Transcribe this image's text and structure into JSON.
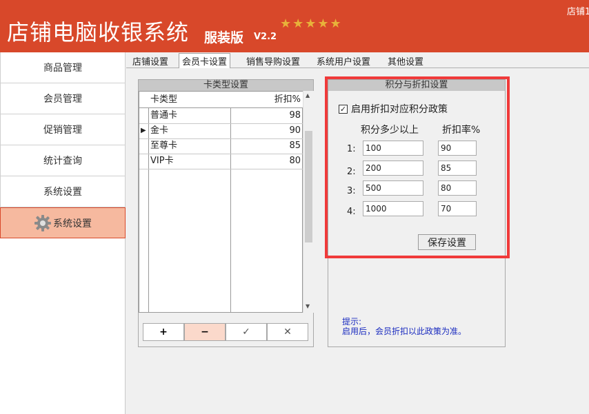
{
  "header": {
    "title": "店铺电脑收银系统",
    "edition": "服装版",
    "version": "V2.2",
    "stars": "★★★★★",
    "store": "店铺1"
  },
  "sidebar": {
    "items": [
      {
        "label": "商品管理"
      },
      {
        "label": "会员管理"
      },
      {
        "label": "促销管理"
      },
      {
        "label": "统计查询"
      },
      {
        "label": "系统设置"
      },
      {
        "label": "系统设置",
        "icon": "gear-icon"
      }
    ]
  },
  "tabs": [
    {
      "label": "店铺设置"
    },
    {
      "label": "会员卡设置"
    },
    {
      "label": "销售导购设置"
    },
    {
      "label": "系统用户设置"
    },
    {
      "label": "其他设置"
    }
  ],
  "card_types": {
    "title": "卡类型设置",
    "columns": [
      "卡类型",
      "折扣%"
    ],
    "rows": [
      {
        "name": "普通卡",
        "discount": "98"
      },
      {
        "name": "金卡",
        "discount": "90"
      },
      {
        "name": "至尊卡",
        "discount": "85"
      },
      {
        "name": "VIP卡",
        "discount": "80"
      }
    ],
    "buttons": {
      "add": "+",
      "remove": "−",
      "confirm": "✓",
      "cancel": "✕"
    }
  },
  "points": {
    "title": "积分与折扣设置",
    "checkbox_label": "启用折扣对应积分政策",
    "col_points": "积分多少以上",
    "col_rate": "折扣率%",
    "rows": [
      {
        "no": "1:",
        "points": "100",
        "rate": "90"
      },
      {
        "no": "2:",
        "points": "200",
        "rate": "85"
      },
      {
        "no": "3:",
        "points": "500",
        "rate": "80"
      },
      {
        "no": "4:",
        "points": "1000",
        "rate": "70"
      }
    ],
    "save_label": "保存设置",
    "tip_title": "提示:",
    "tip_text": "启用后，会员折扣以此政策为准。"
  }
}
